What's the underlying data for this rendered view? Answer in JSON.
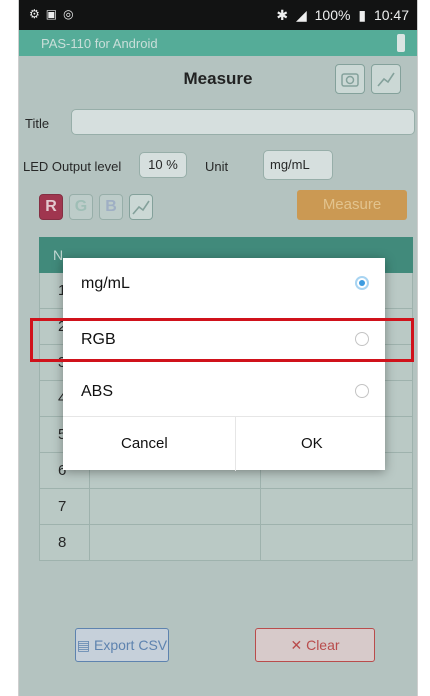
{
  "status_bar": {
    "left_icons": [
      "settings-icon",
      "gallery-icon",
      "sync-icon"
    ],
    "battery": "100%",
    "time": "10:47"
  },
  "app": {
    "title": "PAS-110 for Android"
  },
  "screen": {
    "title": "Measure"
  },
  "form": {
    "title_label": "Title",
    "title_value": "",
    "led_label": "LED Output level",
    "led_value": "10 %",
    "unit_label": "Unit",
    "unit_value": "mg/mL"
  },
  "channels": [
    {
      "label": "R",
      "active": true
    },
    {
      "label": "G",
      "active": false
    },
    {
      "label": "B",
      "active": false
    }
  ],
  "measure_button": "Measure",
  "table": {
    "header_first": "N",
    "row_numbers": [
      "1",
      "2",
      "3",
      "4",
      "5",
      "6",
      "7",
      "8"
    ]
  },
  "dialog": {
    "options": [
      {
        "label": "mg/mL",
        "selected": true
      },
      {
        "label": "RGB",
        "selected": false
      },
      {
        "label": "ABS",
        "selected": false
      }
    ],
    "cancel": "Cancel",
    "ok": "OK"
  },
  "footer": {
    "export": "Export CSV",
    "clear": "Clear"
  },
  "colors": {
    "accent": "#55b59f",
    "measure": "#d9a052",
    "highlight": "#d0121b",
    "radio_on": "#3d9be0"
  }
}
